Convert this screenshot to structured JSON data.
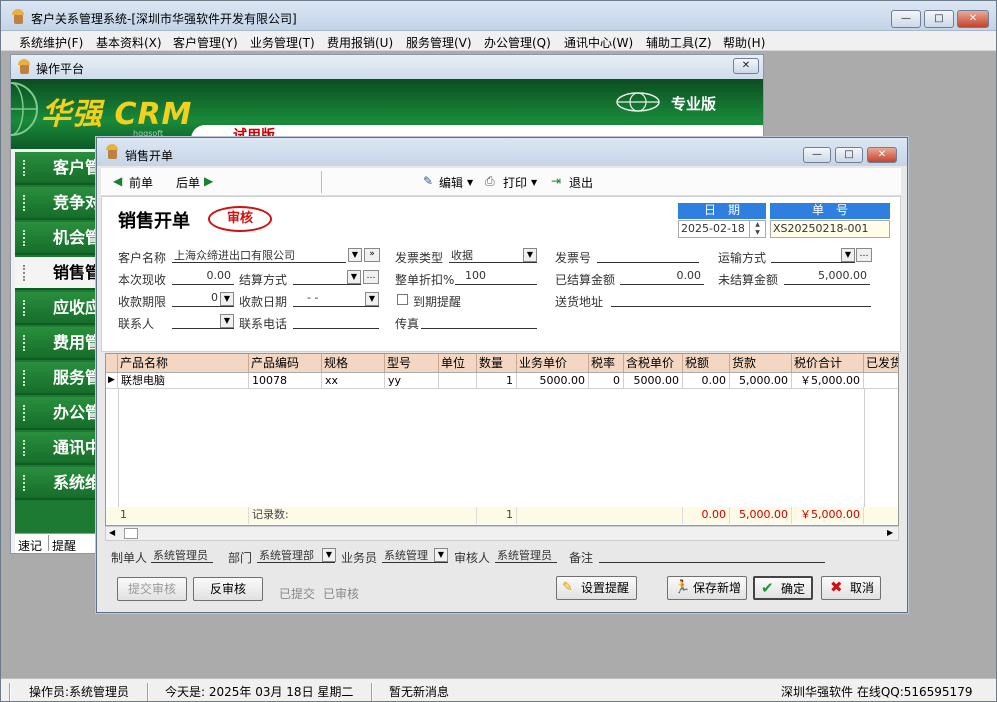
{
  "app": {
    "title": "客户关系管理系统-[深圳市华强软件开发有限公司]",
    "win_min": "—",
    "win_max": "□",
    "win_close": "✕"
  },
  "menu": [
    "系统维护(F)",
    "基本资料(X)",
    "客户管理(Y)",
    "业务管理(T)",
    "费用报销(U)",
    "服务管理(V)",
    "办公管理(Q)",
    "通讯中心(W)",
    "辅助工具(Z)",
    "帮助(H)"
  ],
  "platform": {
    "title": "操作平台",
    "logo": "华强 CRM",
    "logo_sub": "hqqsoft",
    "edition": "专业版",
    "trial": "试用版",
    "nav": [
      "客户管",
      "竞争对",
      "机会管",
      "销售管",
      "应收应",
      "费用管",
      "服务管",
      "办公管",
      "通讯中",
      "系统维"
    ],
    "selected_nav": 3,
    "tabs": [
      "速记",
      "提醒"
    ]
  },
  "dialog": {
    "title": "销售开单",
    "toolbar": {
      "prev": "前单",
      "next": "后单",
      "edit": "编辑",
      "print": "打印",
      "exit": "退出"
    },
    "heading": "销售开单",
    "stamp": "审核",
    "date_label": "日　期",
    "date_value": "2025-02-18",
    "no_label": "单　号",
    "no_value": "XS20250218-001",
    "fields": {
      "customer_label": "客户名称",
      "customer_value": "上海众缔进出口有限公司",
      "invoice_type_label": "发票类型",
      "invoice_type_value": "收据",
      "invoice_no_label": "发票号",
      "invoice_no_value": "",
      "ship_label": "运输方式",
      "ship_value": "",
      "cash_label": "本次现收",
      "cash_value": "0.00",
      "settle_label": "结算方式",
      "settle_value": "",
      "discount_label": "整单折扣%",
      "discount_value": "100",
      "settled_label": "已结算金额",
      "settled_value": "0.00",
      "unsettled_label": "未结算金额",
      "unsettled_value": "5,000.00",
      "term_label": "收款期限",
      "term_value": "0",
      "due_label": "收款日期",
      "due_value": "- -",
      "remind_label": "到期提醒",
      "address_label": "送货地址",
      "address_value": "",
      "contact_label": "联系人",
      "contact_value": "",
      "phone_label": "联系电话",
      "phone_value": "",
      "fax_label": "传真",
      "fax_value": ""
    },
    "grid": {
      "columns": [
        "产品名称",
        "产品编码",
        "规格",
        "型号",
        "单位",
        "数量",
        "业务单价",
        "税率",
        "含税单价",
        "税额",
        "货款",
        "税价合计",
        "已发货"
      ],
      "rows": [
        [
          "联想电脑",
          "10078",
          "xx",
          "yy",
          "",
          "1",
          "5000.00",
          "0",
          "5000.00",
          "0.00",
          "5,000.00",
          "￥5,000.00",
          ""
        ]
      ],
      "footer": {
        "index": "1",
        "record_label": "记录数:",
        "qty": "1",
        "tax": "0.00",
        "amount": "5,000.00",
        "total": "￥5,000.00"
      }
    },
    "bottom": {
      "maker_label": "制单人",
      "maker_value": "系统管理员",
      "dept_label": "部门",
      "dept_value": "系统管理部",
      "sales_label": "业务员",
      "sales_value": "系统管理",
      "auditor_label": "审核人",
      "auditor_value": "系统管理员",
      "note_label": "备注",
      "note_value": ""
    },
    "buttons": {
      "submit_audit": "提交审核",
      "unaudit": "反审核",
      "submitted": "已提交",
      "audited": "已审核",
      "reminder": "设置提醒",
      "save_new": "保存新增",
      "ok": "确定",
      "cancel": "取消"
    }
  },
  "status": {
    "operator": "操作员:系统管理员",
    "today": "今天是: 2025年 03月 18日  星期二",
    "messages": "暂无新消息",
    "company": "深圳华强软件 在线QQ:516595179"
  }
}
